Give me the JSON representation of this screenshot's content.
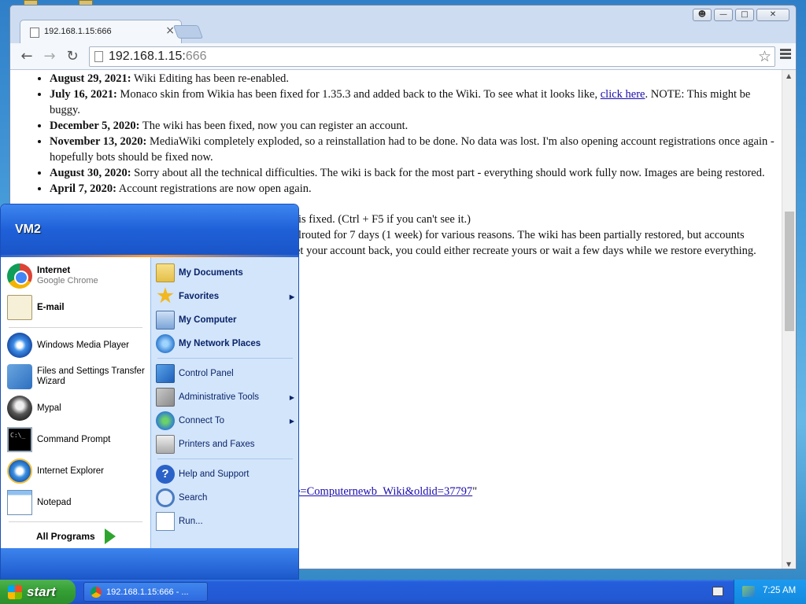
{
  "browser": {
    "tab_title": "192.168.1.15:666",
    "url_host": "192.168.1.15:",
    "url_port": "666",
    "close_tab": "×"
  },
  "content": {
    "items": [
      {
        "date": "August 29, 2021:",
        "text": " Wiki Editing has been re-enabled."
      },
      {
        "date": "July 16, 2021:",
        "text": " Monaco skin from Wikia has been fixed for 1.35.3 and added back to the Wiki. To see what it looks like, ",
        "link": "click here",
        "after": ". NOTE: This might be buggy."
      },
      {
        "date": "December 5, 2020:",
        "text": " The wiki has been fixed, now you can register an account."
      },
      {
        "date": "November 13, 2020:",
        "text": " MediaWiki completely exploded, so a reinstallation had to be done. No data was lost. I'm also opening account registrations once again - hopefully bots should be fixed now."
      },
      {
        "date": "August 30, 2020:",
        "text": " Sorry about all the technical difficulties. The wiki is back for the most part - everything should work fully now. Images are being restored."
      },
      {
        "date": "April 7, 2020:",
        "text": " Account registrations are now open again."
      }
    ],
    "partial_lines": [
      "is fixed. (Ctrl + F5 if you can't see it.)",
      "llrouted for 7 days (1 week) for various reasons. The wiki has been partially restored, but accounts",
      "et your account back, you could either recreate yours or wait a few days while we restore everything."
    ],
    "old_link": "e=Computernewb_Wiki&oldid=37797",
    "old_link_suffix": "\""
  },
  "start_menu": {
    "user": "VM2",
    "left_items": [
      {
        "label": "Internet",
        "sub": "Google Chrome",
        "icon": "chrome-icon"
      },
      {
        "label": "E-mail",
        "icon": "email-icon"
      },
      {
        "label": "Windows Media Player",
        "icon": "media-player-icon"
      },
      {
        "label": "Files and Settings Transfer",
        "label2": "Wizard",
        "icon": "transfer-wizard-icon"
      },
      {
        "label": "Mypal",
        "icon": "mypal-icon"
      },
      {
        "label": "Command Prompt",
        "icon": "command-prompt-icon"
      },
      {
        "label": "Internet Explorer",
        "icon": "internet-explorer-icon"
      },
      {
        "label": "Notepad",
        "icon": "notepad-icon"
      }
    ],
    "all_programs": "All Programs",
    "right_items": [
      {
        "label": "My Documents"
      },
      {
        "label": "Favorites"
      },
      {
        "label": "My Computer"
      },
      {
        "label": "My Network Places"
      },
      {
        "label": "Control Panel"
      },
      {
        "label": "Administrative Tools"
      },
      {
        "label": "Connect To"
      },
      {
        "label": "Printers and Faxes"
      },
      {
        "label": "Help and Support"
      },
      {
        "label": "Search"
      },
      {
        "label": "Run..."
      }
    ]
  },
  "taskbar": {
    "start_label": "start",
    "task_item": "192.168.1.15:666 - ...",
    "clock": "7:25 AM"
  }
}
